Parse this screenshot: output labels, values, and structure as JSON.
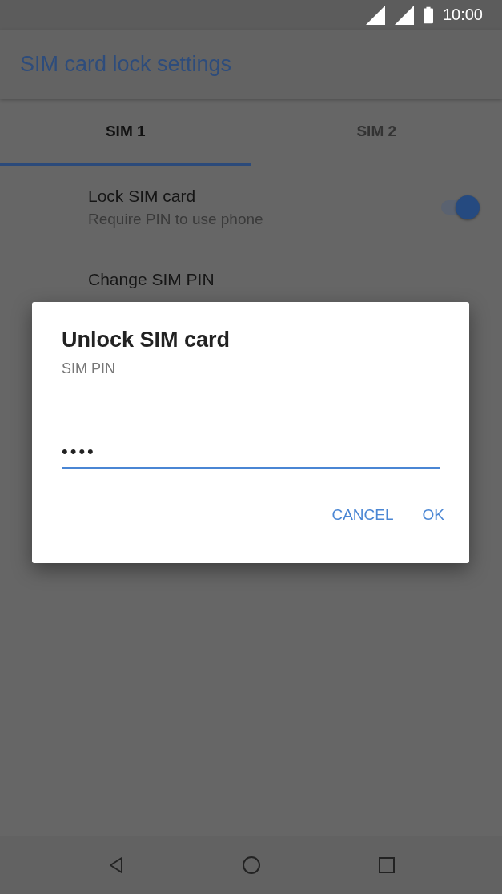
{
  "status_bar": {
    "time": "10:00"
  },
  "app_bar": {
    "title": "SIM card lock settings"
  },
  "tabs": [
    {
      "label": "SIM 1",
      "selected": true
    },
    {
      "label": "SIM 2",
      "selected": false
    }
  ],
  "settings": [
    {
      "kind": "switch",
      "title": "Lock SIM card",
      "subtitle": "Require PIN to use phone",
      "on": true
    },
    {
      "kind": "plain",
      "title": "Change SIM PIN"
    }
  ],
  "dialog": {
    "title": "Unlock SIM card",
    "message": "SIM PIN",
    "field": {
      "value": "••••"
    },
    "buttons": [
      "CANCEL",
      "OK"
    ]
  }
}
